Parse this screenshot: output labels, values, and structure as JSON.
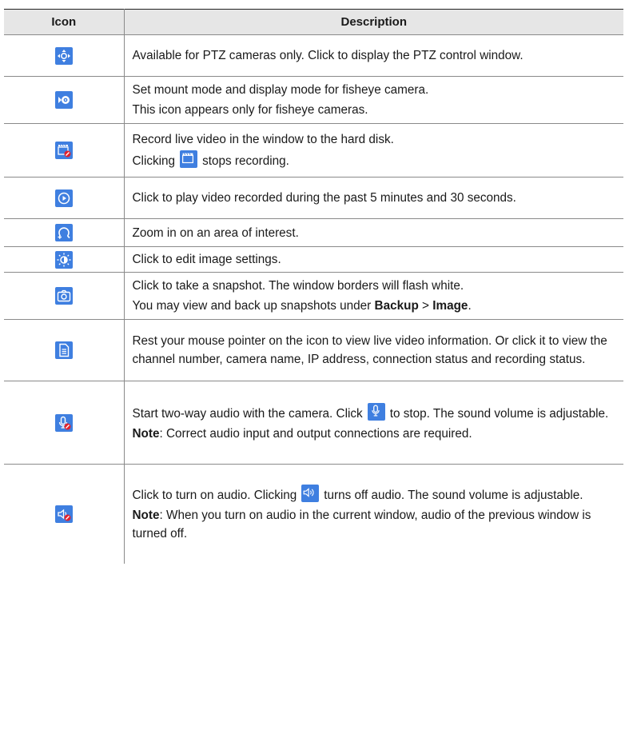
{
  "headers": {
    "icon": "Icon",
    "description": "Description"
  },
  "rows": [
    {
      "icon": "ptz-icon",
      "lines": [
        "Available for PTZ cameras only. Click to display the PTZ control window."
      ]
    },
    {
      "icon": "fisheye-icon",
      "lines": [
        "Set mount mode and display mode for fisheye camera.",
        "This icon appears only for fisheye cameras."
      ]
    },
    {
      "icon": "record-off-icon",
      "line1": "Record live video in the window to the hard disk.",
      "line2_pre": "Clicking",
      "line2_icon": "record-on-icon",
      "line2_post": "stops recording."
    },
    {
      "icon": "instant-playback-icon",
      "lines": [
        "Click to play video recorded during the past 5 minutes and 30 seconds."
      ]
    },
    {
      "icon": "zoom-icon",
      "lines": [
        "Zoom in on an area of interest."
      ]
    },
    {
      "icon": "image-settings-icon",
      "lines": [
        "Click to edit image settings."
      ]
    },
    {
      "icon": "snapshot-icon",
      "line1": "Click to take a snapshot. The window borders will flash white.",
      "line2_pre": "You may view and back up snapshots under ",
      "line2_b1": "Backup",
      "line2_mid": " > ",
      "line2_b2": "Image",
      "line2_post": "."
    },
    {
      "icon": "info-icon",
      "lines": [
        "Rest your mouse pointer on the icon to view live video information. Or click it to view the channel number, camera name, IP address, connection status and recording status."
      ]
    },
    {
      "icon": "two-way-audio-off-icon",
      "line1_pre": "Start two-way audio with the camera. Click",
      "line1_icon": "two-way-audio-on-icon",
      "line1_post": "to stop. The sound volume is adjustable.",
      "note_label": "Note",
      "note_text": ": Correct audio input and output connections are required."
    },
    {
      "icon": "audio-off-icon",
      "line1_pre": "Click to turn on audio. Clicking",
      "line1_icon": "audio-on-icon",
      "line1_post": "turns off audio. The sound volume is adjustable.",
      "note_label": "Note",
      "note_text": ": When you turn on audio in the current window, audio of the previous window is turned off."
    }
  ],
  "colors": {
    "icon_bg": "#3f7fe0",
    "header_bg": "#e6e6e6",
    "badge_red": "#e0222e"
  }
}
